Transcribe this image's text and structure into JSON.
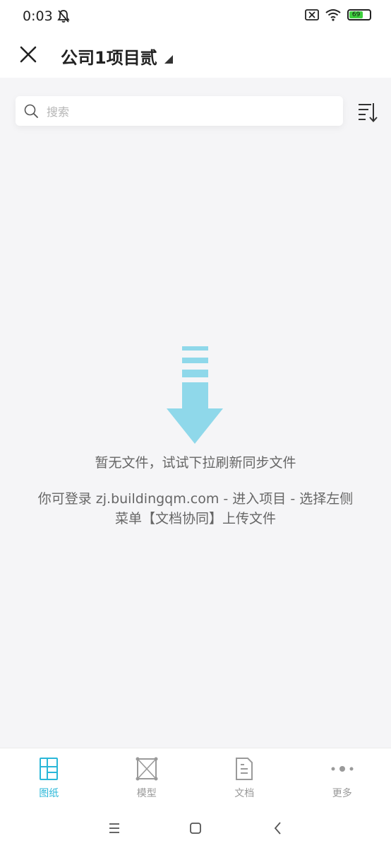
{
  "status_bar": {
    "time": "0:03",
    "battery_level": "69"
  },
  "header": {
    "title": "公司1项目贰"
  },
  "search": {
    "placeholder": "搜索"
  },
  "empty_state": {
    "message": "暂无文件，试试下拉刷新同步文件",
    "hint_line1": "你可登录 zj.buildingqm.com - 进入项目 - 选择左侧",
    "hint_line2": "菜单【文档协同】上传文件"
  },
  "tabs": [
    {
      "label": "图纸",
      "icon": "drawing-icon",
      "active": true
    },
    {
      "label": "模型",
      "icon": "model-icon",
      "active": false
    },
    {
      "label": "文档",
      "icon": "document-icon",
      "active": false
    },
    {
      "label": "更多",
      "icon": "more-icon",
      "active": false
    }
  ],
  "colors": {
    "accent": "#2ab7d8",
    "illustration": "#8fd8ea",
    "inactive_icon": "#9a9a9a",
    "background": "#f5f5f7"
  }
}
